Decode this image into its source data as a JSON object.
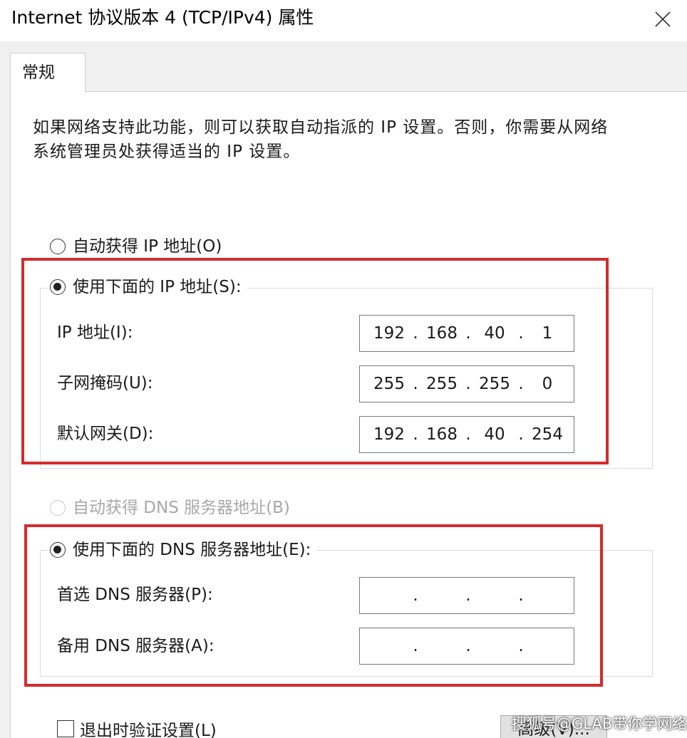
{
  "window": {
    "title": "Internet 协议版本 4 (TCP/IPv4) 属性",
    "close_icon": "close-icon"
  },
  "tabs": [
    {
      "label": "常规",
      "selected": true
    }
  ],
  "description": "如果网络支持此功能，则可以获取自动指派的 IP 设置。否则，你需要从网络系统管理员处获得适当的 IP 设置。",
  "ip_section": {
    "auto_option": {
      "label": "自动获得 IP 地址(O)",
      "checked": false
    },
    "manual_option": {
      "label": "使用下面的 IP 地址(S):",
      "checked": true
    },
    "fields": [
      {
        "label": "IP 地址(I):",
        "octets": [
          "192",
          "168",
          "40",
          "1"
        ]
      },
      {
        "label": "子网掩码(U):",
        "octets": [
          "255",
          "255",
          "255",
          "0"
        ]
      },
      {
        "label": "默认网关(D):",
        "octets": [
          "192",
          "168",
          "40",
          "254"
        ]
      }
    ]
  },
  "dns_section": {
    "auto_option": {
      "label": "自动获得 DNS 服务器地址(B)",
      "checked": false,
      "disabled": true
    },
    "manual_option": {
      "label": "使用下面的 DNS 服务器地址(E):",
      "checked": true
    },
    "fields": [
      {
        "label": "首选 DNS 服务器(P):",
        "octets": [
          "",
          "",
          "",
          ""
        ]
      },
      {
        "label": "备用 DNS 服务器(A):",
        "octets": [
          "",
          "",
          "",
          ""
        ]
      }
    ]
  },
  "validate_checkbox": {
    "label": "退出时验证设置(L)",
    "checked": false
  },
  "advanced_button": {
    "label": "高级(V)..."
  },
  "watermark": "搜狐号@GLAB带你学网络",
  "colors": {
    "highlight": "#d42b2e",
    "dialog_bg": "#f0f0f0",
    "panel_bg": "#ffffff"
  }
}
